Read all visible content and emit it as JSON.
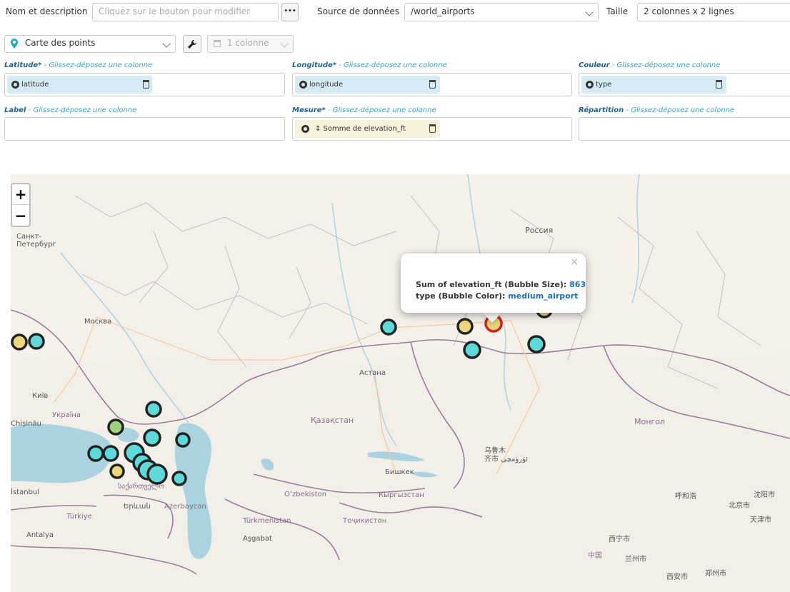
{
  "toolbar": {
    "name_label": "Nom et description",
    "name_placeholder": "Cliquez sur le bouton pour modifier",
    "more_button": "•••",
    "source_label": "Source de données",
    "source_value": "/world_airports",
    "size_label": "Taille",
    "size_value": "2 colonnes x 2 lignes"
  },
  "viz": {
    "type_value": "Carte des points",
    "columns_value": "1 colonne"
  },
  "fields": {
    "latitude": {
      "name": "Latitude*",
      "hint": " - Glissez-déposez une colonne",
      "chip": "latitude"
    },
    "longitude": {
      "name": "Longitude*",
      "hint": " - Glissez-déposez une colonne",
      "chip": "longitude"
    },
    "color": {
      "name": "Couleur",
      "hint": " - Glissez-déposez une colonne",
      "chip": "type"
    },
    "label": {
      "name": "Label",
      "hint": " - Glissez-déposez une colonne"
    },
    "measure": {
      "name": "Mesure*",
      "hint": " - Glissez-déposez une colonne",
      "chip": "↕ Somme de elevation_ft"
    },
    "split": {
      "name": "Répartition",
      "hint": " - Glissez-déposez une colonne"
    }
  },
  "map": {
    "zoom_in": "+",
    "zoom_out": "−",
    "popup": {
      "close": "×",
      "size_label": "Sum of elevation_ft (Bubble Size): ",
      "size_value": "863",
      "color_label": "type (Bubble Color): ",
      "color_value": "medium_airport"
    },
    "places": {
      "russia": "Россия",
      "spb": "Санкт-\nПетербург",
      "moscow": "Москва",
      "astana": "Астана",
      "kyiv": "Київ",
      "ukraine": "Україна",
      "chisinau": "Chișinău",
      "kazakhstan": "Қазақстан",
      "mongolia": "Монгол",
      "urumqi": "乌鲁木\n齐市 ئۈرۈمچى",
      "bishkek": "Бишкек",
      "kyrgyzstan": "Кыргызстан",
      "uzbekistan": "Oʻzbekiston",
      "tajikistan": "Тоҷикистон",
      "turkmenistan": "Türkmenistan",
      "ashgabat": "Aşgabat",
      "istanbul": "İstanbul",
      "turkiye": "Türkiye",
      "antalya": "Antalya",
      "azerbaijan": "Azerbaycan",
      "yerevan": "Երևան",
      "georgia": "საქართველო",
      "hohhot": "呼和浩",
      "beijing": "北京市",
      "xining": "西宁市",
      "lanzhou": "兰州市",
      "china": "中国",
      "xian": "西安市",
      "zhengzhou": "郑州市",
      "shenyang": "沈阳市",
      "tianjin": "天津市"
    }
  },
  "colors": {
    "cyan_bubble": "#5ed8d8",
    "yellow_bubble": "#ecd67a",
    "green_bubble": "#9fd27a",
    "highlight_ring": "#d0221c",
    "water": "#aad3df"
  }
}
